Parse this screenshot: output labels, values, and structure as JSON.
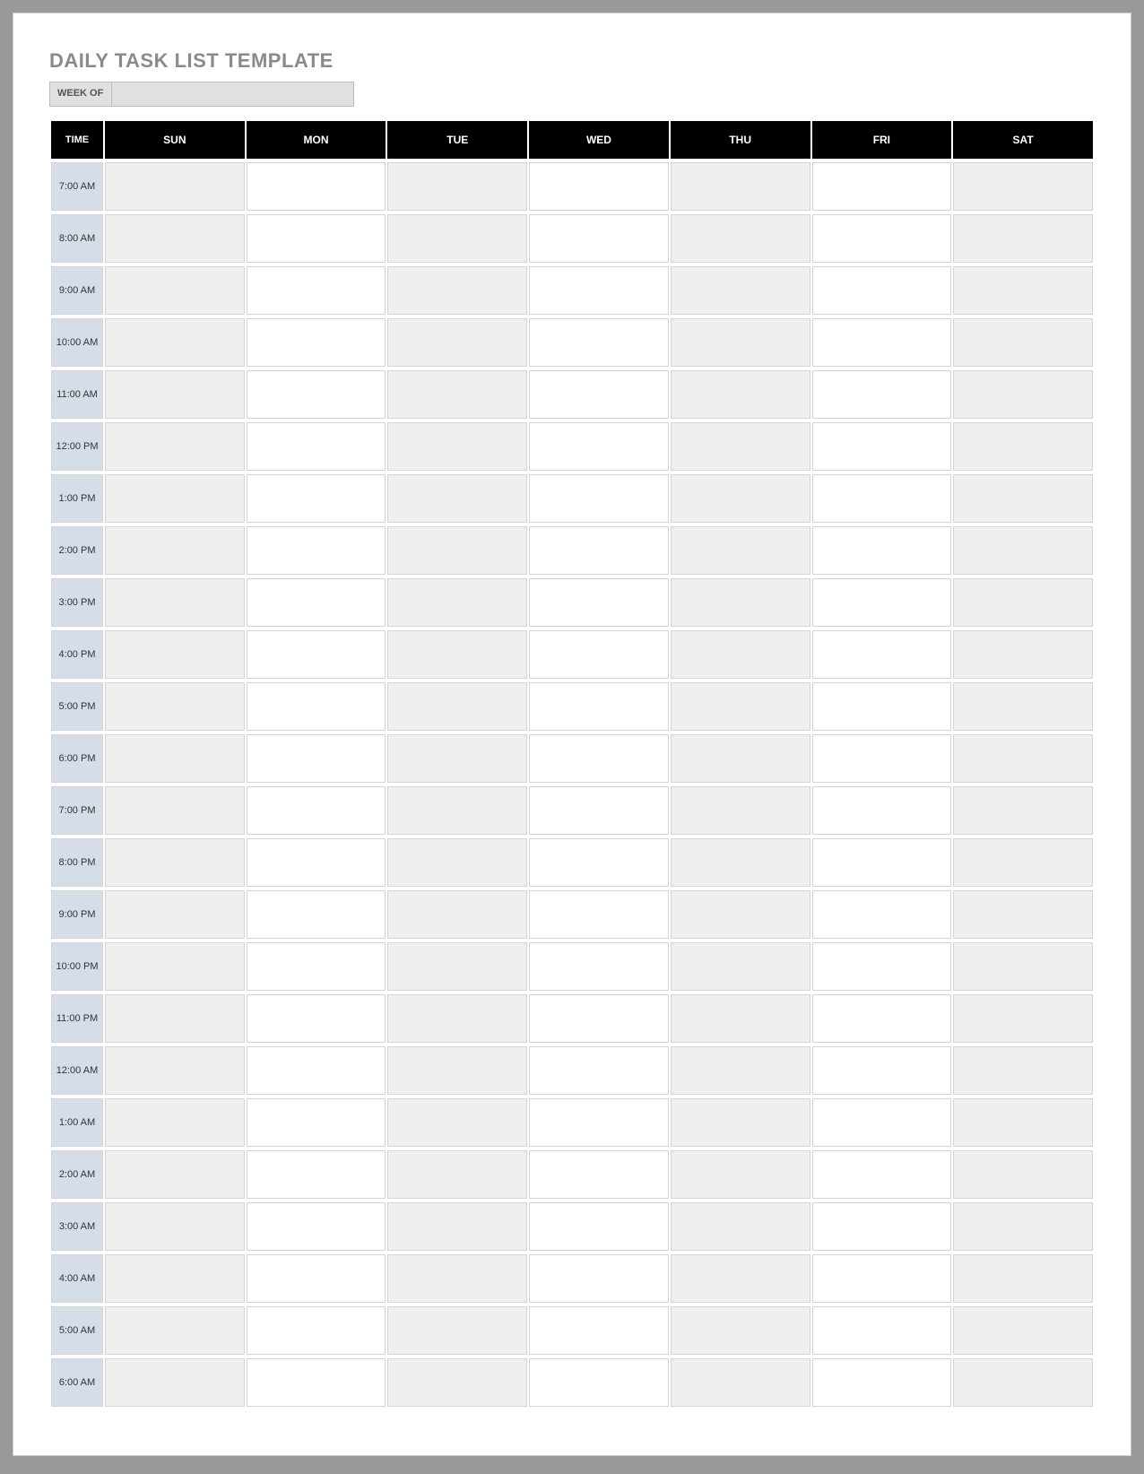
{
  "title": "DAILY TASK LIST TEMPLATE",
  "weekof_label": "WEEK OF",
  "weekof_value": "",
  "headers": {
    "time": "TIME",
    "sun": "SUN",
    "mon": "MON",
    "tue": "TUE",
    "wed": "WED",
    "thu": "THU",
    "fri": "FRI",
    "sat": "SAT"
  },
  "times": [
    "7:00 AM",
    "8:00 AM",
    "9:00 AM",
    "10:00 AM",
    "11:00 AM",
    "12:00 PM",
    "1:00 PM",
    "2:00 PM",
    "3:00 PM",
    "4:00 PM",
    "5:00 PM",
    "6:00 PM",
    "7:00 PM",
    "8:00 PM",
    "9:00 PM",
    "10:00 PM",
    "11:00 PM",
    "12:00 AM",
    "1:00 AM",
    "2:00 AM",
    "3:00 AM",
    "4:00 AM",
    "5:00 AM",
    "6:00 AM"
  ]
}
